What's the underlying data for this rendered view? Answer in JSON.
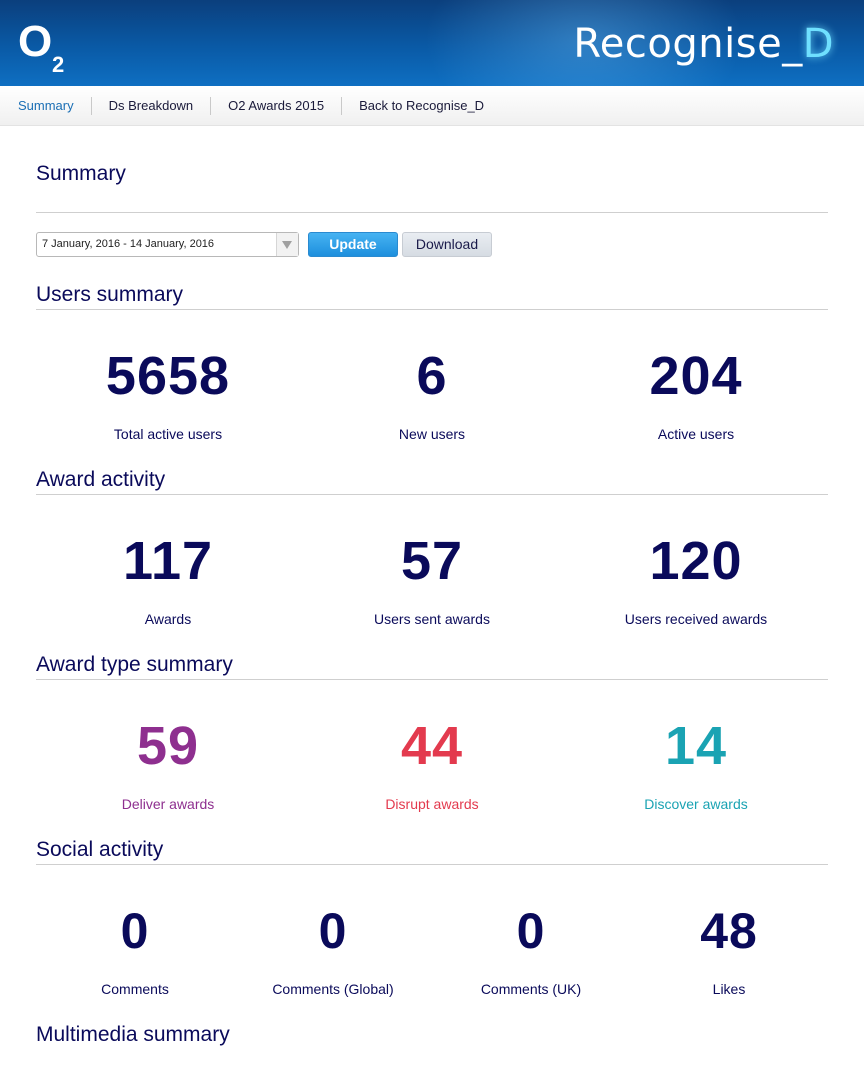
{
  "header": {
    "logo_text": "O",
    "logo_sub": "2",
    "brand_main": "Recognise_",
    "brand_accent": "D"
  },
  "nav": {
    "items": [
      {
        "label": "Summary",
        "active": true
      },
      {
        "label": "Ds Breakdown",
        "active": false
      },
      {
        "label": "O2 Awards 2015",
        "active": false
      },
      {
        "label": "Back to Recognise_D",
        "active": false
      }
    ]
  },
  "summary": {
    "title": "Summary",
    "date_range": "7 January, 2016 - 14 January, 2016",
    "update_label": "Update",
    "download_label": "Download"
  },
  "users_summary": {
    "title": "Users summary",
    "stats": [
      {
        "value": "5658",
        "label": "Total active users"
      },
      {
        "value": "6",
        "label": "New users"
      },
      {
        "value": "204",
        "label": "Active users"
      }
    ]
  },
  "award_activity": {
    "title": "Award activity",
    "stats": [
      {
        "value": "117",
        "label": "Awards"
      },
      {
        "value": "57",
        "label": "Users sent awards"
      },
      {
        "value": "120",
        "label": "Users received awards"
      }
    ]
  },
  "award_type_summary": {
    "title": "Award type summary",
    "stats": [
      {
        "value": "59",
        "label": "Deliver awards",
        "color": "#8e2f8f"
      },
      {
        "value": "44",
        "label": "Disrupt awards",
        "color": "#e33a4e"
      },
      {
        "value": "14",
        "label": "Discover awards",
        "color": "#1aa3b3"
      }
    ]
  },
  "social_activity": {
    "title": "Social activity",
    "stats": [
      {
        "value": "0",
        "label": "Comments"
      },
      {
        "value": "0",
        "label": "Comments (Global)"
      },
      {
        "value": "0",
        "label": "Comments (UK)"
      },
      {
        "value": "48",
        "label": "Likes"
      }
    ]
  },
  "multimedia_summary": {
    "title": "Multimedia summary"
  },
  "colors": {
    "header_bg": "#0a5aa6",
    "text_primary": "#0a0a5a",
    "nav_active": "#1b6fb5",
    "update_button": "#1d8fdd"
  }
}
